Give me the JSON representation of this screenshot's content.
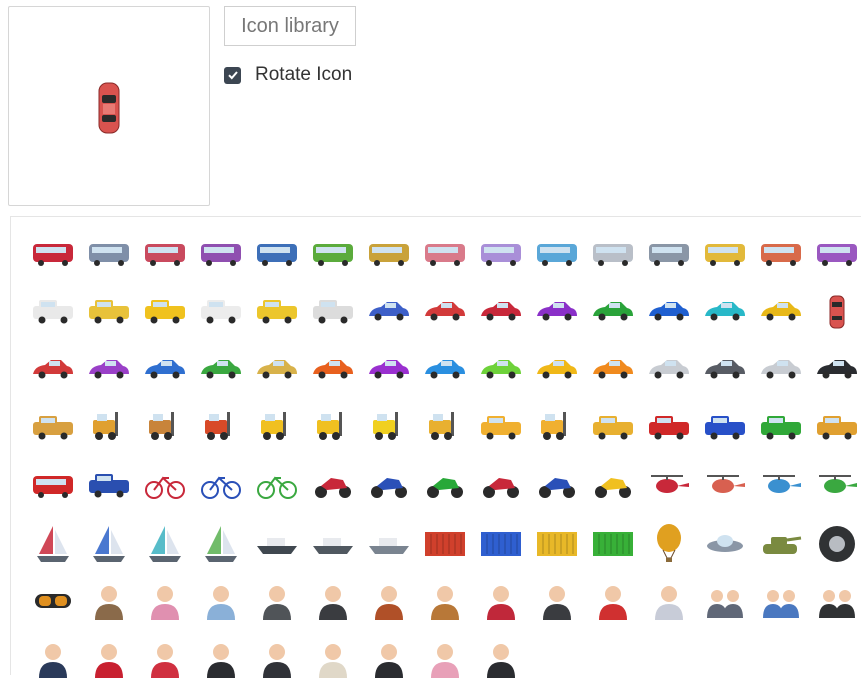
{
  "controls": {
    "library_button": "Icon library",
    "rotate_label": "Rotate Icon",
    "rotate_checked": true
  },
  "preview": {
    "icon": "red-car-topview-icon",
    "color": "#d9534f"
  },
  "icons": [
    {
      "name": "tram",
      "c": "#c8283a"
    },
    {
      "name": "bus",
      "c": "#7f8fa8"
    },
    {
      "name": "bus",
      "c": "#c94a5e"
    },
    {
      "name": "bus",
      "c": "#8f4fb0"
    },
    {
      "name": "bus",
      "c": "#3d6fb8"
    },
    {
      "name": "bus",
      "c": "#5bab3c"
    },
    {
      "name": "bus",
      "c": "#c9a23a"
    },
    {
      "name": "coach",
      "c": "#d97a8a"
    },
    {
      "name": "coach",
      "c": "#a98fd8"
    },
    {
      "name": "coach",
      "c": "#5aa7d8"
    },
    {
      "name": "coach",
      "c": "#b9bfc8"
    },
    {
      "name": "coach",
      "c": "#8a96a6"
    },
    {
      "name": "bus",
      "c": "#e2b93a"
    },
    {
      "name": "bus",
      "c": "#d86a4a"
    },
    {
      "name": "bus",
      "c": "#9a58c0"
    },
    {
      "name": "van",
      "c": "#e9e9e9"
    },
    {
      "name": "van",
      "c": "#e8c23a"
    },
    {
      "name": "taxi",
      "c": "#f0c21e"
    },
    {
      "name": "pickup",
      "c": "#ececec"
    },
    {
      "name": "pickup",
      "c": "#ecc62c"
    },
    {
      "name": "truck",
      "c": "#dcdcdc"
    },
    {
      "name": "car-group",
      "c": "#3d5fc8"
    },
    {
      "name": "car-group",
      "c": "#d23a3a"
    },
    {
      "name": "sports-car",
      "c": "#c8283a"
    },
    {
      "name": "sports-car",
      "c": "#8a30c8"
    },
    {
      "name": "sports-car",
      "c": "#2aa33a"
    },
    {
      "name": "sports-car",
      "c": "#1f5fd0"
    },
    {
      "name": "sports-car",
      "c": "#28b8c8"
    },
    {
      "name": "sports-car",
      "c": "#e8b818"
    },
    {
      "name": "car-topview",
      "c": "#d9534f"
    },
    {
      "name": "convertible",
      "c": "#d23a3a"
    },
    {
      "name": "convertible",
      "c": "#9a40c8"
    },
    {
      "name": "convertible",
      "c": "#2f6fd0"
    },
    {
      "name": "convertible",
      "c": "#3aa840"
    },
    {
      "name": "convertible",
      "c": "#d8b24a"
    },
    {
      "name": "hatchback",
      "c": "#e8601e"
    },
    {
      "name": "hatchback",
      "c": "#9a30d0"
    },
    {
      "name": "hatchback",
      "c": "#2a8fe0"
    },
    {
      "name": "hatchback",
      "c": "#6ed23a"
    },
    {
      "name": "hatchback",
      "c": "#f0b818"
    },
    {
      "name": "hatchback",
      "c": "#f08a1e"
    },
    {
      "name": "sedan",
      "c": "#c8ccd2"
    },
    {
      "name": "sedan",
      "c": "#585c64"
    },
    {
      "name": "sedan",
      "c": "#c8ccd2"
    },
    {
      "name": "sedan",
      "c": "#2a2c30"
    },
    {
      "name": "tow-truck",
      "c": "#d8a040"
    },
    {
      "name": "excavator",
      "c": "#e0a030"
    },
    {
      "name": "forklift-boxes",
      "c": "#c8843a"
    },
    {
      "name": "forklift-boxes",
      "c": "#d84a28"
    },
    {
      "name": "forklift",
      "c": "#f0c020"
    },
    {
      "name": "road-roller",
      "c": "#f0c020"
    },
    {
      "name": "road-roller",
      "c": "#f0d020"
    },
    {
      "name": "forklift",
      "c": "#e8b030"
    },
    {
      "name": "mixer-truck",
      "c": "#f0b030"
    },
    {
      "name": "excavator",
      "c": "#f0b030"
    },
    {
      "name": "crane-truck",
      "c": "#e8b030"
    },
    {
      "name": "pickup",
      "c": "#d02828"
    },
    {
      "name": "pickup",
      "c": "#2850c8"
    },
    {
      "name": "pickup",
      "c": "#30a838"
    },
    {
      "name": "pickup",
      "c": "#e0a030"
    },
    {
      "name": "fire-truck",
      "c": "#d02828"
    },
    {
      "name": "police-car",
      "c": "#2a4fb0"
    },
    {
      "name": "bicycle",
      "c": "#c8283a"
    },
    {
      "name": "bicycle",
      "c": "#2a50b8"
    },
    {
      "name": "bicycle",
      "c": "#3aa840"
    },
    {
      "name": "motorcycle",
      "c": "#c8283a"
    },
    {
      "name": "motorcycle",
      "c": "#2a50b8"
    },
    {
      "name": "motorcycle",
      "c": "#28a838"
    },
    {
      "name": "quad-bike",
      "c": "#c8283a"
    },
    {
      "name": "quad-bike",
      "c": "#2a50b8"
    },
    {
      "name": "snowmobile",
      "c": "#f0c020"
    },
    {
      "name": "helicopter",
      "c": "#c8283a"
    },
    {
      "name": "helicopter",
      "c": "#d86050"
    },
    {
      "name": "helicopter",
      "c": "#3a90d0"
    },
    {
      "name": "helicopter",
      "c": "#3aa840"
    },
    {
      "name": "sailboat",
      "c": "#c8283a"
    },
    {
      "name": "sailboat",
      "c": "#2a60c8"
    },
    {
      "name": "sailboat",
      "c": "#3ab0c0"
    },
    {
      "name": "sailboat",
      "c": "#58b050"
    },
    {
      "name": "ship",
      "c": "#404850"
    },
    {
      "name": "speedboat",
      "c": "#505860"
    },
    {
      "name": "hovercraft",
      "c": "#7a8490"
    },
    {
      "name": "container",
      "c": "#d0402c"
    },
    {
      "name": "container",
      "c": "#2f5fd0"
    },
    {
      "name": "container",
      "c": "#e8b828"
    },
    {
      "name": "container",
      "c": "#38b038"
    },
    {
      "name": "balloon",
      "c": "#e0a020"
    },
    {
      "name": "ufo",
      "c": "#8a96a6"
    },
    {
      "name": "tank",
      "c": "#7a8a40"
    },
    {
      "name": "tire",
      "c": "#303234"
    },
    {
      "name": "diving-mask",
      "c": "#e09020"
    },
    {
      "name": "person",
      "c": "#8a6a4a"
    },
    {
      "name": "person",
      "c": "#e090b0"
    },
    {
      "name": "person",
      "c": "#8ab0d8"
    },
    {
      "name": "person",
      "c": "#505458"
    },
    {
      "name": "person",
      "c": "#3a3c40"
    },
    {
      "name": "person-cowboy",
      "c": "#b05028"
    },
    {
      "name": "person-cowboy",
      "c": "#b87838"
    },
    {
      "name": "person",
      "c": "#c0283a"
    },
    {
      "name": "person",
      "c": "#3a3c40"
    },
    {
      "name": "person",
      "c": "#d03030"
    },
    {
      "name": "person-nurse",
      "c": "#c8ccd8"
    },
    {
      "name": "people-group",
      "c": "#606878"
    },
    {
      "name": "people-group",
      "c": "#4a78c0"
    },
    {
      "name": "people-group",
      "c": "#303234"
    },
    {
      "name": "person-pilot",
      "c": "#2a3a5a"
    },
    {
      "name": "person-santa",
      "c": "#c82030"
    },
    {
      "name": "person-santa",
      "c": "#d03040"
    },
    {
      "name": "person",
      "c": "#2a2c30"
    },
    {
      "name": "person",
      "c": "#303238"
    },
    {
      "name": "person",
      "c": "#e0d8c8"
    },
    {
      "name": "person",
      "c": "#2a2c30"
    },
    {
      "name": "person",
      "c": "#e8a0b8"
    },
    {
      "name": "person",
      "c": "#2a2c30"
    }
  ]
}
